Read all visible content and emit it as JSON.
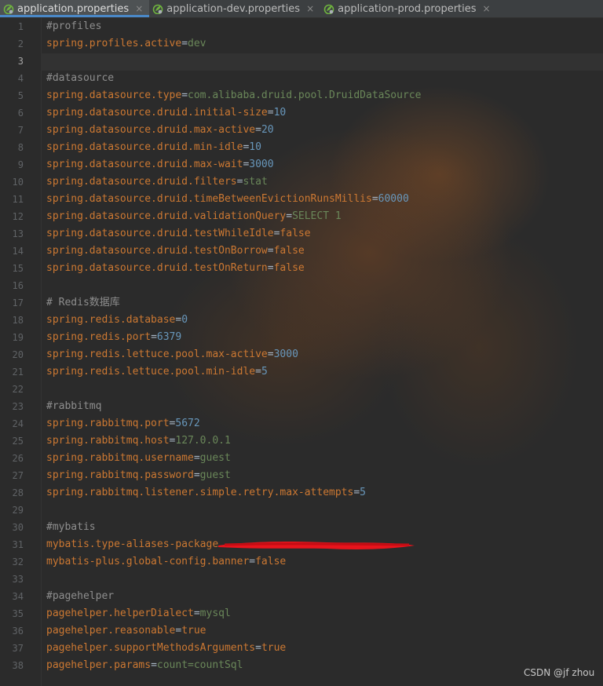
{
  "tabs": [
    {
      "label": "application.properties",
      "active": true,
      "icon": "spring-leaf-icon"
    },
    {
      "label": "application-dev.properties",
      "active": false,
      "icon": "spring-leaf-icon"
    },
    {
      "label": "application-prod.properties",
      "active": false,
      "icon": "spring-leaf-icon"
    }
  ],
  "close_glyph": "×",
  "current_line": 3,
  "lines": [
    {
      "n": "1",
      "type": "comment",
      "text": "#profiles"
    },
    {
      "n": "2",
      "type": "prop",
      "key": "spring.profiles.active",
      "value": "dev",
      "vtype": "val"
    },
    {
      "n": "3",
      "type": "blank"
    },
    {
      "n": "4",
      "type": "comment",
      "text": "#datasource"
    },
    {
      "n": "5",
      "type": "prop",
      "key": "spring.datasource.type",
      "value": "com.alibaba.druid.pool.DruidDataSource",
      "vtype": "val"
    },
    {
      "n": "6",
      "type": "prop",
      "key": "spring.datasource.druid.initial-size",
      "value": "10",
      "vtype": "num"
    },
    {
      "n": "7",
      "type": "prop",
      "key": "spring.datasource.druid.max-active",
      "value": "20",
      "vtype": "num"
    },
    {
      "n": "8",
      "type": "prop",
      "key": "spring.datasource.druid.min-idle",
      "value": "10",
      "vtype": "num"
    },
    {
      "n": "9",
      "type": "prop",
      "key": "spring.datasource.druid.max-wait",
      "value": "3000",
      "vtype": "num"
    },
    {
      "n": "10",
      "type": "prop",
      "key": "spring.datasource.druid.filters",
      "value": "stat",
      "vtype": "val"
    },
    {
      "n": "11",
      "type": "prop",
      "key": "spring.datasource.druid.timeBetweenEvictionRunsMillis",
      "value": "60000",
      "vtype": "num"
    },
    {
      "n": "12",
      "type": "prop",
      "key": "spring.datasource.druid.validationQuery",
      "value": "SELECT 1",
      "vtype": "val"
    },
    {
      "n": "13",
      "type": "prop",
      "key": "spring.datasource.druid.testWhileIdle",
      "value": "false",
      "vtype": "bool"
    },
    {
      "n": "14",
      "type": "prop",
      "key": "spring.datasource.druid.testOnBorrow",
      "value": "false",
      "vtype": "bool"
    },
    {
      "n": "15",
      "type": "prop",
      "key": "spring.datasource.druid.testOnReturn",
      "value": "false",
      "vtype": "bool"
    },
    {
      "n": "16",
      "type": "blank"
    },
    {
      "n": "17",
      "type": "comment",
      "text": "# Redis数据库"
    },
    {
      "n": "18",
      "type": "prop",
      "key": "spring.redis.database",
      "value": "0",
      "vtype": "num"
    },
    {
      "n": "19",
      "type": "prop",
      "key": "spring.redis.port",
      "value": "6379",
      "vtype": "num"
    },
    {
      "n": "20",
      "type": "prop",
      "key": "spring.redis.lettuce.pool.max-active",
      "value": "3000",
      "vtype": "num"
    },
    {
      "n": "21",
      "type": "prop",
      "key": "spring.redis.lettuce.pool.min-idle",
      "value": "5",
      "vtype": "num"
    },
    {
      "n": "22",
      "type": "blank"
    },
    {
      "n": "23",
      "type": "comment",
      "text": "#rabbitmq"
    },
    {
      "n": "24",
      "type": "prop",
      "key": "spring.rabbitmq.port",
      "value": "5672",
      "vtype": "num"
    },
    {
      "n": "25",
      "type": "prop",
      "key": "spring.rabbitmq.host",
      "value": "127.0.0.1",
      "vtype": "val"
    },
    {
      "n": "26",
      "type": "prop",
      "key": "spring.rabbitmq.username",
      "value": "guest",
      "vtype": "val"
    },
    {
      "n": "27",
      "type": "prop",
      "key": "spring.rabbitmq.password",
      "value": "guest",
      "vtype": "val"
    },
    {
      "n": "28",
      "type": "prop",
      "key": "spring.rabbitmq.listener.simple.retry.max-attempts",
      "value": "5",
      "vtype": "num"
    },
    {
      "n": "29",
      "type": "blank"
    },
    {
      "n": "30",
      "type": "comment",
      "text": "#mybatis"
    },
    {
      "n": "31",
      "type": "redacted",
      "key": "mybatis.type-aliases-package"
    },
    {
      "n": "32",
      "type": "prop",
      "key": "mybatis-plus.global-config.banner",
      "value": "false",
      "vtype": "bool"
    },
    {
      "n": "33",
      "type": "blank"
    },
    {
      "n": "34",
      "type": "comment",
      "text": "#pagehelper"
    },
    {
      "n": "35",
      "type": "prop",
      "key": "pagehelper.helperDialect",
      "value": "mysql",
      "vtype": "val"
    },
    {
      "n": "36",
      "type": "prop",
      "key": "pagehelper.reasonable",
      "value": "true",
      "vtype": "bool"
    },
    {
      "n": "37",
      "type": "prop",
      "key": "pagehelper.supportMethodsArguments",
      "value": "true",
      "vtype": "bool"
    },
    {
      "n": "38",
      "type": "prop",
      "key": "pagehelper.params",
      "value": "count=countSql",
      "vtype": "val"
    }
  ],
  "equals": "=",
  "watermark": "CSDN @jf zhou",
  "colors": {
    "editor_bg": "#2b2b2b",
    "key": "#cc7832",
    "string_value": "#6a8759",
    "number_value": "#6897bb",
    "comment": "#8e8e8e",
    "redaction": "#e8141c"
  }
}
